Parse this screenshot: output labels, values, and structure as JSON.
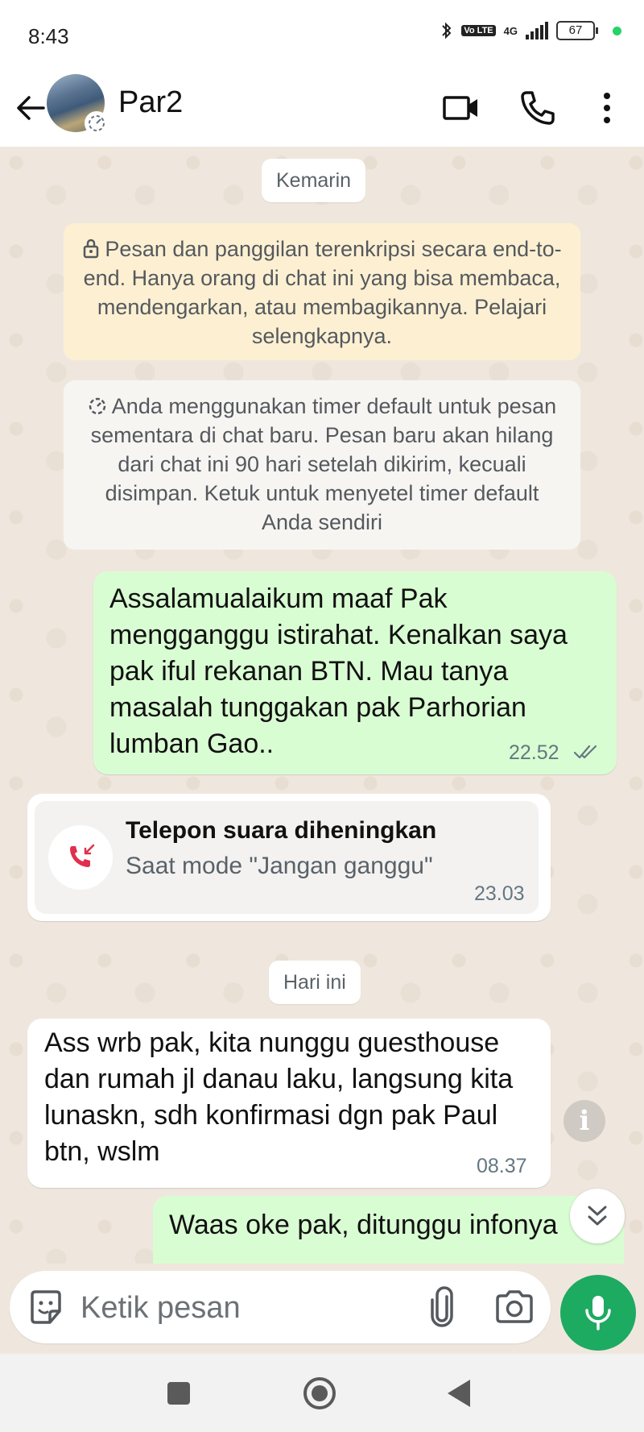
{
  "status_bar": {
    "time": "8:43",
    "network": "4G",
    "volte": "Vo LTE",
    "battery": "67"
  },
  "header": {
    "contact_name": "Par2"
  },
  "chat": {
    "date_yesterday": "Kemarin",
    "encryption_notice": "Pesan dan panggilan terenkripsi secara end-to-end. Hanya orang di chat ini yang bisa membaca, mendengarkan, atau membagikannya. Pelajari selengkapnya.",
    "timer_notice": "Anda menggunakan timer default untuk pesan sementara di chat baru. Pesan baru akan hilang dari chat ini 90 hari setelah dikirim, kecuali disimpan. Ketuk untuk menyetel timer default Anda sendiri",
    "messages": [
      {
        "direction": "outgoing",
        "text": "Assalamualaikum maaf Pak mengganggu istirahat. Kenalkan saya pak iful rekanan BTN. Mau tanya masalah tunggakan pak Parhorian lumban Gao..",
        "time": "22.52",
        "status": "read"
      },
      {
        "direction": "incoming",
        "type": "missed_call",
        "title": "Telepon suara diheningkan",
        "subtitle": "Saat mode \"Jangan ganggu\"",
        "time": "23.03"
      },
      {
        "direction": "incoming",
        "text": "Ass wrb pak, kita nunggu guesthouse dan rumah jl danau laku, langsung kita lunaskn, sdh konfirmasi dgn pak Paul btn, wslm",
        "time": "08.37"
      },
      {
        "direction": "outgoing",
        "text": "Waas oke pak, ditunggu infonya"
      }
    ],
    "date_today": "Hari ini"
  },
  "input_bar": {
    "placeholder": "Ketik pesan"
  },
  "colors": {
    "outgoing_bubble": "#d9fdd3",
    "incoming_bubble": "#ffffff",
    "chat_background": "#efe7dd",
    "encryption_notice_bg": "#fdf0d2",
    "accent_green": "#1daa61",
    "missed_call_red": "#e0304e"
  }
}
